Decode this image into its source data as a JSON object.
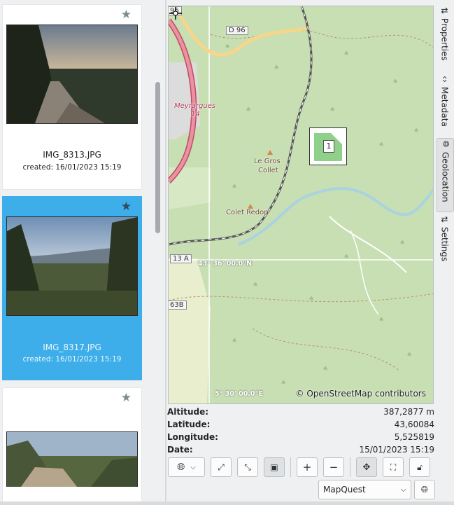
{
  "thumbnails": [
    {
      "name": "IMG_8313.JPG",
      "created": "created: 16/01/2023 15:19",
      "selected": false
    },
    {
      "name": "IMG_8317.JPG",
      "created": "created: 16/01/2023 15:19",
      "selected": true
    },
    {
      "name": "",
      "created": "",
      "selected": false
    }
  ],
  "map": {
    "road_labels": [
      "D 96",
      "96",
      "13 A",
      "63B"
    ],
    "town_label": "Meyrargues",
    "town_number": "14",
    "place_labels": [
      "Le Gros",
      "Collet",
      "Colet Redon"
    ],
    "lat_grid_label": "43° 36' 00.0\"N",
    "lon_grid_label": "5° 30' 00.0\"E",
    "attribution": "© OpenStreetMap contributors",
    "cluster_count": "1"
  },
  "info": {
    "altitude_label": "Altitude:",
    "altitude_value": "387,2877 m",
    "latitude_label": "Latitude:",
    "latitude_value": "43,60084",
    "longitude_label": "Longitude:",
    "longitude_value": "5,525819",
    "date_label": "Date:",
    "date_value": "15/01/2023 15:19"
  },
  "toolbar": {
    "provider": "MapQuest"
  },
  "side_tabs": [
    "Properties",
    "Metadata",
    "Geolocation",
    "Settings"
  ],
  "colors": {
    "selection": "#3daee9",
    "map_forest": "#c7dfb3",
    "road_primary": "#e892a2",
    "railway": "#555555",
    "water": "#aad3df"
  }
}
